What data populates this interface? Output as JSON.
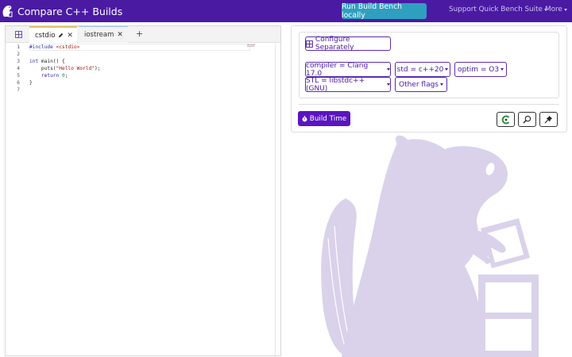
{
  "navbar": {
    "title": "Compare C++ Builds",
    "run_button": "Run Build Bench locally",
    "support_link": "Support Quick Bench Suite",
    "more_link": "More"
  },
  "editor": {
    "tabs": [
      {
        "label": "cstdio"
      },
      {
        "label": "iostream"
      }
    ],
    "add_tab": "+",
    "lines": [
      {
        "num": "1"
      },
      {
        "num": "2"
      },
      {
        "num": "3"
      },
      {
        "num": "4"
      },
      {
        "num": "5"
      },
      {
        "num": "6"
      },
      {
        "num": "7"
      }
    ],
    "tokens": {
      "include_kw": "#include",
      "include_hdr": "<cstdio>",
      "int_kw": "int",
      "main_sig": " main() {",
      "puts_open": "    puts(",
      "hello_str": "\"Hello World\"",
      "puts_close": ");",
      "return_kw": "    return",
      "zero": "0",
      "semi": ";",
      "close_brace": "}"
    }
  },
  "config": {
    "configure_separately": "Configure Separately",
    "dropdowns": {
      "compiler": "compiler = Clang 17.0",
      "std": "std = c++20",
      "optim": "optim = O3",
      "stl": "STL = libstdc++(GNU)",
      "other": "Other flags"
    },
    "build_button": "Build Time"
  },
  "colors": {
    "navbar": "#4a1aa3",
    "run_button": "#2f9fbf",
    "build_button": "#5a15c0",
    "beaver": "#d9d2ea"
  }
}
